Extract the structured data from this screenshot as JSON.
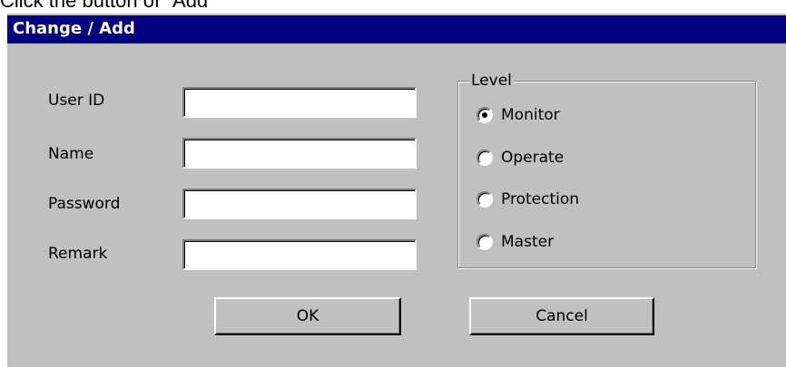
{
  "caption": "Click  the  button  of  \"Add\"",
  "dialog": {
    "title": "Change / Add",
    "fields": {
      "user_id": {
        "label": "User ID",
        "value": ""
      },
      "name": {
        "label": "Name",
        "value": ""
      },
      "password": {
        "label": "Password",
        "value": ""
      },
      "remark": {
        "label": "Remark",
        "value": ""
      }
    },
    "level_group": {
      "legend": "Level",
      "options": [
        {
          "label": "Monitor",
          "selected": true
        },
        {
          "label": "Operate",
          "selected": false
        },
        {
          "label": "Protection",
          "selected": false
        },
        {
          "label": "Master",
          "selected": false
        }
      ]
    },
    "buttons": {
      "ok": "OK",
      "cancel": "Cancel"
    }
  },
  "colors": {
    "titlebar": "#000080",
    "dialog_face": "#c0c0c0"
  }
}
